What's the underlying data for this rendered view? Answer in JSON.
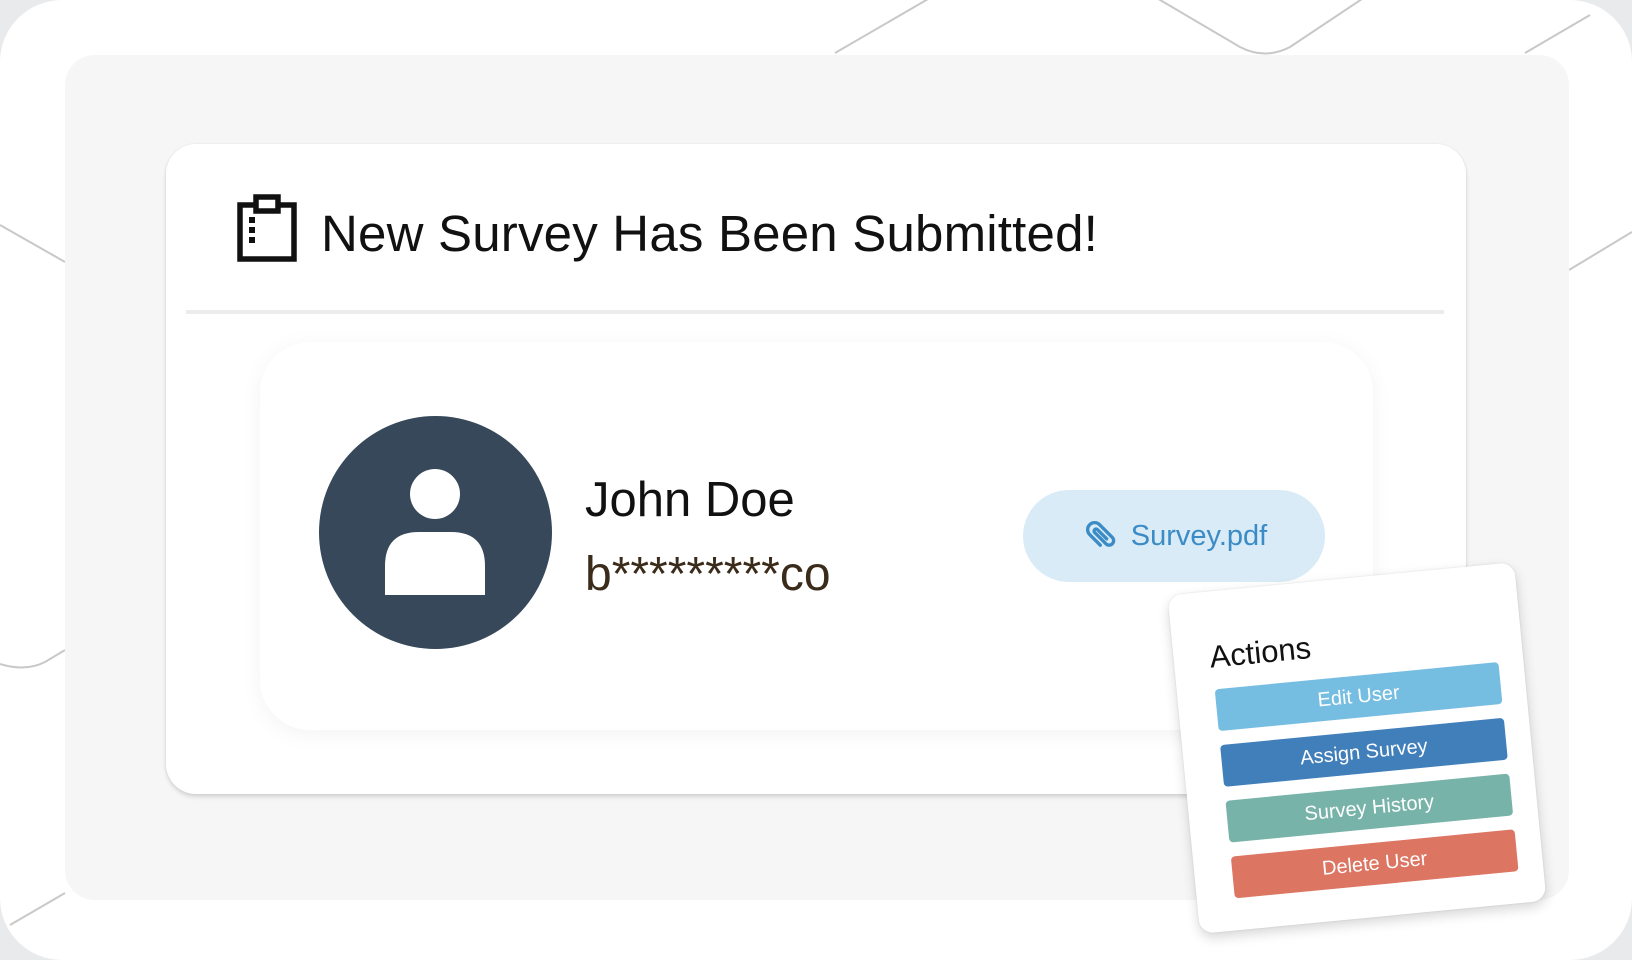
{
  "notification": {
    "title": "New Survey Has Been Submitted!",
    "icon": "clipboard-icon"
  },
  "user": {
    "name": "John Doe",
    "email_masked": "b*********co",
    "avatar_icon": "user-icon"
  },
  "attachment": {
    "label": "Survey.pdf",
    "icon": "paperclip-icon",
    "color": "#3b8cc6",
    "background": "#d8ebf6"
  },
  "actions": {
    "title": "Actions",
    "buttons": [
      {
        "label": "Edit User",
        "color": "#76bde2"
      },
      {
        "label": "Assign Survey",
        "color": "#417fbb"
      },
      {
        "label": "Survey History",
        "color": "#78b3a9"
      },
      {
        "label": "Delete User",
        "color": "#dc7562"
      }
    ]
  },
  "colors": {
    "avatar": "#364859",
    "panel": "#f6f6f6",
    "card": "#ffffff"
  }
}
